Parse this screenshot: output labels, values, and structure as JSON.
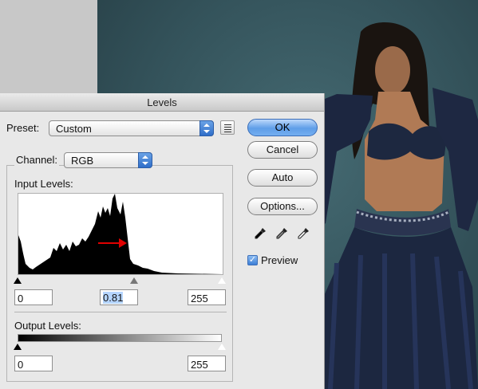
{
  "dialog": {
    "title": "Levels",
    "preset_label": "Preset:",
    "preset_value": "Custom",
    "channel_label": "Channel:",
    "channel_value": "RGB",
    "input_levels_label": "Input Levels:",
    "input_black": "0",
    "input_gamma": "0.81",
    "input_white": "255",
    "output_levels_label": "Output Levels:",
    "output_black": "0",
    "output_white": "255",
    "buttons": {
      "ok": "OK",
      "cancel": "Cancel",
      "auto": "Auto",
      "options": "Options..."
    },
    "preview_label": "Preview",
    "preview_checked": true
  },
  "colors": {
    "accent_blue": "#5f9ee8",
    "arrow_red": "#e00000",
    "photo_bg": "#34535b",
    "dress": "#1c2740"
  },
  "icons": [
    "preset-menu-icon",
    "black-eyedropper-icon",
    "gray-eyedropper-icon",
    "white-eyedropper-icon",
    "checkmark-icon",
    "red-arrow-icon"
  ]
}
